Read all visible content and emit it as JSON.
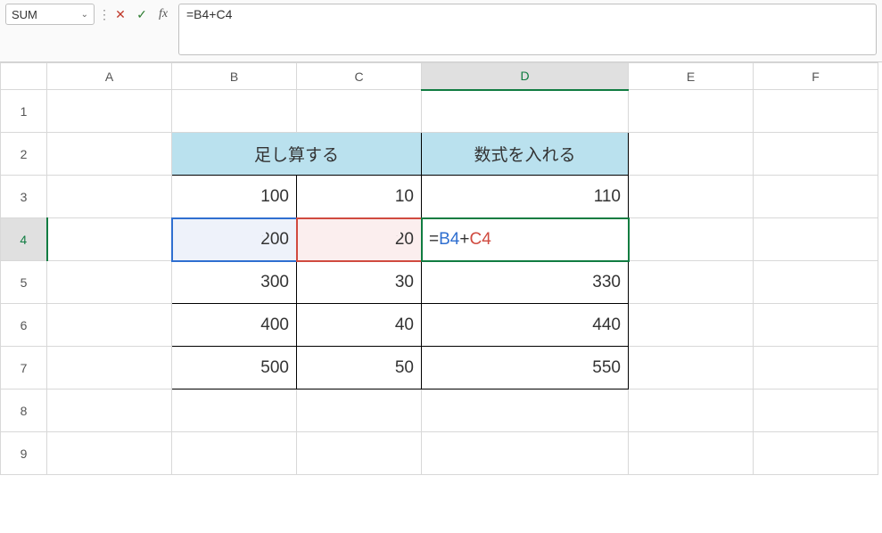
{
  "namebox": {
    "value": "SUM"
  },
  "formula_bar": {
    "value": "=B4+C4"
  },
  "columns": [
    "A",
    "B",
    "C",
    "D",
    "E",
    "F"
  ],
  "row_count": 9,
  "active": {
    "col": "D",
    "row": 4
  },
  "headers": {
    "sum_label": "足し算する",
    "formula_label": "数式を入れる"
  },
  "data": {
    "B3": "100",
    "C3": "10",
    "D3": "110",
    "B4": "200",
    "C4": "20",
    "B5": "300",
    "C5": "30",
    "D5": "330",
    "B6": "400",
    "C6": "40",
    "D6": "440",
    "B7": "500",
    "C7": "50",
    "D7": "550"
  },
  "edit_formula": {
    "eq": "=",
    "ref1": "B4",
    "op": "+",
    "ref2": "C4"
  },
  "icons": {
    "dropdown": "⌄",
    "menu": "⋮",
    "cancel": "✕",
    "confirm": "✓",
    "fx": "fx"
  }
}
